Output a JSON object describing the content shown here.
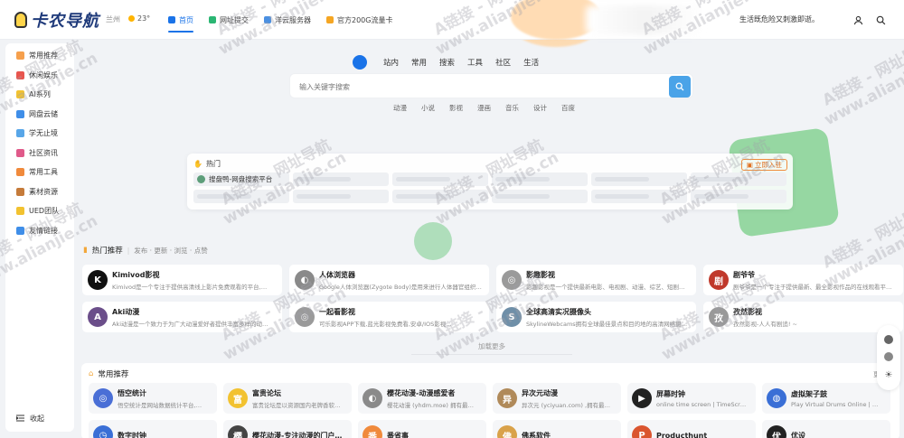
{
  "header": {
    "logo_text": "卡农导航",
    "city": "兰州",
    "temperature": "23°",
    "nav": [
      {
        "label": "首页",
        "color": "#1a73e8",
        "active": true
      },
      {
        "label": "网址提交",
        "color": "#2bb673"
      },
      {
        "label": "洋云服务器",
        "color": "#4a90e2"
      },
      {
        "label": "官方200G流量卡",
        "color": "#f5a623"
      }
    ],
    "motto": "生活既危险又刺激即逝。"
  },
  "sidebar": {
    "items": [
      {
        "label": "常用推荐",
        "color": "#f6a04d"
      },
      {
        "label": "休闲娱乐",
        "color": "#e8554e"
      },
      {
        "label": "AI系列",
        "color": "#f2c230"
      },
      {
        "label": "网盘云储",
        "color": "#3f8ee8"
      },
      {
        "label": "学无止境",
        "color": "#58a6e8"
      },
      {
        "label": "社区资讯",
        "color": "#e05a8a"
      },
      {
        "label": "常用工具",
        "color": "#f08a3c"
      },
      {
        "label": "素材资源",
        "color": "#c57b3a"
      },
      {
        "label": "UED团队",
        "color": "#f2c230"
      },
      {
        "label": "友情链接",
        "color": "#3f8ee8"
      }
    ],
    "collapse_label": "收起"
  },
  "search": {
    "tabs": [
      "站内",
      "常用",
      "搜索",
      "工具",
      "社区",
      "生活"
    ],
    "placeholder": "输入关键字搜索",
    "sub_tabs": [
      "动漫",
      "小说",
      "影视",
      "漫画",
      "音乐",
      "设计",
      "百度"
    ]
  },
  "hot": {
    "title": "热门",
    "submit_label": "立即入驻",
    "first_item": "搜盘鸭-网盘搜索平台"
  },
  "recommend": {
    "title": "热门推荐",
    "subtitle": "发布 · 更新 · 浏览 · 点赞",
    "load_more": "加载更多",
    "cards": [
      {
        "name": "Kimivod影视",
        "desc": "Kimivod是一个专注于提供高清线上影片免费观看的平台,…",
        "icon_bg": "#111111",
        "icon_char": "K"
      },
      {
        "name": "人体浏览器",
        "desc": "Google人体浏览器(Zygote Body)是用来进行人体器官组织…",
        "icon_bg": "#8a8a8a",
        "icon_char": "◐"
      },
      {
        "name": "影趣影视",
        "desc": "影趣影视是一个提供最新电影、电视剧、动漫、综艺、短剧…",
        "icon_bg": "#9a9a9a",
        "icon_char": "◎"
      },
      {
        "name": "剧爷爷",
        "desc": "剧爷爷是一个专注于提供最新、最全影视作品的在线观看平…",
        "icon_bg": "#c0392b",
        "icon_char": "剧"
      },
      {
        "name": "Aki动漫",
        "desc": "Aki动漫是一个致力于为广大动漫爱好者提供丰富多样的动…",
        "icon_bg": "#6b4e8a",
        "icon_char": "A"
      },
      {
        "name": "一起看影视",
        "desc": "可乐影视APP下载,蓝光影视免费看,安卓/IOS影视…",
        "icon_bg": "#9a9a9a",
        "icon_char": "◎"
      },
      {
        "name": "全球高清实况摄像头",
        "desc": "SkylineWebcams拥有全球最佳景点和目的地的高清网络摄…",
        "icon_bg": "#6f8fa8",
        "icon_char": "S"
      },
      {
        "name": "孜然影视",
        "desc": "孜然影视-人人有剧追! ~",
        "icon_bg": "#999999",
        "icon_char": "孜"
      }
    ]
  },
  "common": {
    "title": "常用推荐",
    "more_label": "更多",
    "cards": [
      {
        "name": "悟空统计",
        "desc": "悟空统计是网站数据统计平台,…",
        "icon_bg": "#4a6fd6",
        "icon_char": "◎"
      },
      {
        "name": "富贵论坛",
        "desc": "富贵论坛是以资源国内老牌香软件…",
        "icon_bg": "#f2c230",
        "icon_char": "富"
      },
      {
        "name": "樱花动漫-动漫感爱者",
        "desc": "樱花动漫 (yhdm.moe) 拥有最…",
        "icon_bg": "#8a8a8a",
        "icon_char": "◐"
      },
      {
        "name": "异次元动漫",
        "desc": "异次元 (yciyuan.com) ,拥有最…",
        "icon_bg": "#b08a5a",
        "icon_char": "异"
      },
      {
        "name": "屏幕时钟",
        "desc": "online time screen | TimeScreen…",
        "icon_bg": "#222222",
        "icon_char": "▶"
      },
      {
        "name": "虚拟架子鼓",
        "desc": "Play Virtual Drums Online | Virtu…",
        "icon_bg": "#3a6fd6",
        "icon_char": "◍"
      },
      {
        "name": "数字时钟",
        "desc": "",
        "icon_bg": "#3a6fd6",
        "icon_char": "◷"
      },
      {
        "name": "樱花动漫-专注动漫的门户…",
        "desc": "",
        "icon_bg": "#444444",
        "icon_char": "樱"
      },
      {
        "name": "番省事",
        "desc": "",
        "icon_bg": "#f08a3c",
        "icon_char": "番"
      },
      {
        "name": "佛系软件",
        "desc": "",
        "icon_bg": "#d9a24a",
        "icon_char": "佛"
      },
      {
        "name": "Producthunt",
        "desc": "",
        "icon_bg": "#da552f",
        "icon_char": "P"
      },
      {
        "name": "优设",
        "desc": "",
        "icon_bg": "#222222",
        "icon_char": "优"
      }
    ]
  },
  "watermark": {
    "line1": "A链接 - 网址导航",
    "line2": "www.alianjie.cn"
  }
}
